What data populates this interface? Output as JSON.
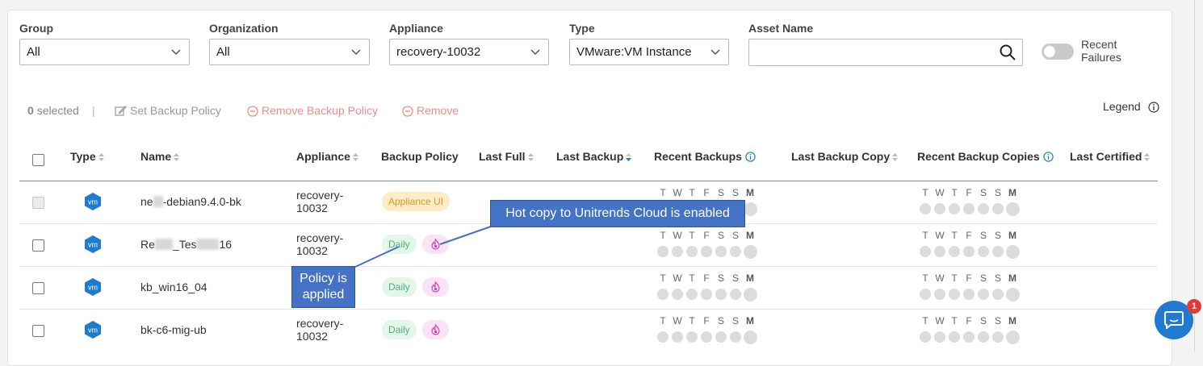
{
  "filters": {
    "group": {
      "label": "Group",
      "value": "All"
    },
    "organization": {
      "label": "Organization",
      "value": "All"
    },
    "appliance": {
      "label": "Appliance",
      "value": "recovery-10032"
    },
    "type": {
      "label": "Type",
      "value": "VMware:VM Instance"
    },
    "asset_name": {
      "label": "Asset Name",
      "value": "",
      "icon": "search-icon"
    },
    "recent_failures": {
      "label_line1": "Recent",
      "label_line2": "Failures",
      "enabled": false
    }
  },
  "actions": {
    "selected_count": "0",
    "selected_label": "selected",
    "separator": "|",
    "set_backup_policy": "Set Backup Policy",
    "remove_backup_policy": "Remove Backup Policy",
    "remove": "Remove",
    "legend": "Legend"
  },
  "columns": [
    "Type",
    "Name",
    "Appliance",
    "Backup Policy",
    "Last Full",
    "Last Backup",
    "Recent Backups",
    "Last Backup Copy",
    "Recent Backup Copies",
    "Last Certified"
  ],
  "day_letters": [
    "T",
    "W",
    "T",
    "F",
    "S",
    "S",
    "M"
  ],
  "rows": [
    {
      "type_icon": "vm",
      "name_start": "ne",
      "name_end": "-debian9.4.0-bk",
      "appliance_line1": "recovery-",
      "appliance_line2": "10032",
      "policy": "Appliance UI",
      "hot_copy": false,
      "disabled": true
    },
    {
      "type_icon": "vm",
      "name_start": "Re",
      "name_mid": "_Tes",
      "name_end": "16",
      "appliance_line1": "recovery-",
      "appliance_line2": "10032",
      "policy": "Daily",
      "hot_copy": true,
      "disabled": false
    },
    {
      "type_icon": "vm",
      "name_start": "kb_win16_04",
      "appliance_line1": "",
      "appliance_line2": "",
      "policy": "Daily",
      "hot_copy": true,
      "disabled": false
    },
    {
      "type_icon": "vm",
      "name_start": "bk-c6-mig-ub",
      "appliance_line1": "recovery-",
      "appliance_line2": "10032",
      "policy": "Daily",
      "hot_copy": true,
      "disabled": false
    }
  ],
  "callouts": {
    "hot_copy": "Hot copy to Unitrends Cloud is enabled",
    "policy_line1": "Policy is",
    "policy_line2": "applied"
  },
  "chat": {
    "badge": "1"
  },
  "colors": {
    "accent": "#1f7bd1",
    "callout": "#4472c4",
    "danger": "#f08b8b"
  }
}
